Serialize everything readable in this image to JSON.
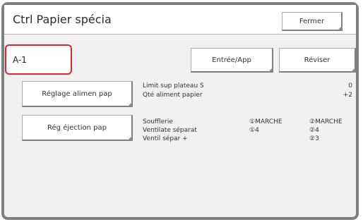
{
  "header": {
    "title": "Ctrl Papier spécia",
    "close_label": "Fermer"
  },
  "selection": {
    "code": "A-1",
    "entry_label": "Entrée/App",
    "review_label": "Réviser"
  },
  "feed": {
    "button_label": "Réglage alimen pap",
    "rows": [
      {
        "label": "Limit sup plateau S",
        "value": "0"
      },
      {
        "label": "Qté aliment papier",
        "value": "+2"
      }
    ]
  },
  "ejection": {
    "button_label": "Rég éjection pap",
    "labels": [
      "Soufflerie",
      "Ventilate séparat",
      "Ventil sépar +"
    ],
    "col1": [
      "①MARCHE",
      "①4",
      ""
    ],
    "col2": [
      "②MARCHE",
      "②4",
      "②3"
    ]
  },
  "colors": {
    "highlight": "#e5232f",
    "frame": "#7f7f7f"
  }
}
